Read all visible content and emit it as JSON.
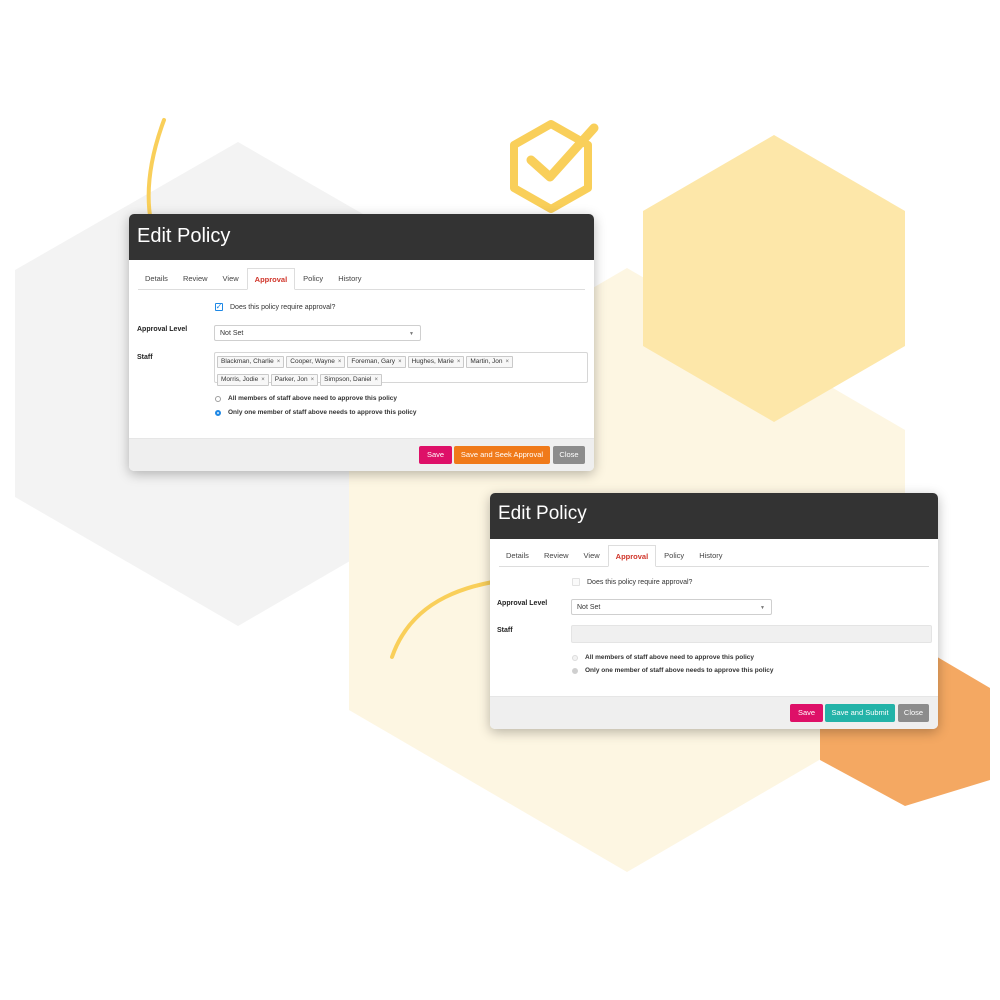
{
  "colors": {
    "accent_yellow": "#f9cf5a",
    "pale_yellow": "#fde7a9",
    "orange": "#f4a862",
    "grey_hex": "#f3f3f3",
    "header": "#333333",
    "save": "#de1068",
    "seek": "#f07a1a",
    "submit": "#23b3a8",
    "close": "#8c8c8c",
    "active_tab": "#d0352a"
  },
  "decor": {
    "check_badge_icon": "hexagon-check-icon",
    "arrow_icon": "curved-arrow-icon"
  },
  "dialog_a": {
    "title": "Edit Policy",
    "tabs": [
      "Details",
      "Review",
      "View",
      "Approval",
      "Policy",
      "History"
    ],
    "active_tab": "Approval",
    "requires_approval_label": "Does this policy require approval?",
    "requires_approval_checked": true,
    "approval_level_label": "Approval Level",
    "approval_level_value": "Not Set",
    "staff_label": "Staff",
    "staff": [
      "Blackman, Charlie",
      "Cooper, Wayne",
      "Foreman, Gary",
      "Hughes, Marie",
      "Martin, Jon",
      "Morris, Jodie",
      "Parker, Jon",
      "Simpson, Daniel"
    ],
    "option_all": "All members of staff above need to approve this policy",
    "option_one": "Only one member of staff above needs to approve this policy",
    "selected_option": "one",
    "buttons": {
      "save": "Save",
      "seek": "Save and Seek Approval",
      "close": "Close"
    }
  },
  "dialog_b": {
    "title": "Edit Policy",
    "tabs": [
      "Details",
      "Review",
      "View",
      "Approval",
      "Policy",
      "History"
    ],
    "active_tab": "Approval",
    "requires_approval_label": "Does this policy require approval?",
    "requires_approval_checked": false,
    "approval_level_label": "Approval Level",
    "approval_level_value": "Not Set",
    "staff_label": "Staff",
    "option_all": "All members of staff above need to approve this policy",
    "option_one": "Only one member of staff above needs to approve this policy",
    "selected_option": "one",
    "buttons": {
      "save": "Save",
      "submit": "Save and Submit",
      "close": "Close"
    }
  }
}
